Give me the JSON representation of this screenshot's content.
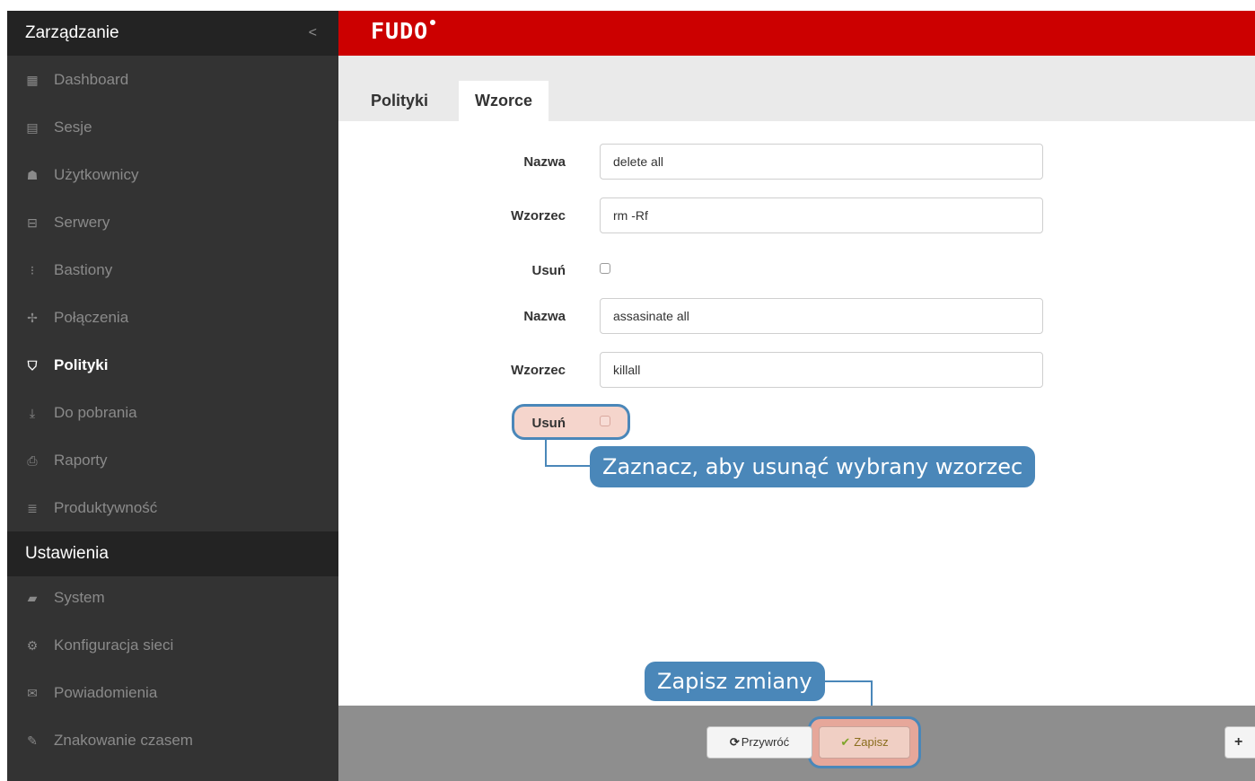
{
  "sidebar": {
    "section1_title": "Zarządzanie",
    "collapse_glyph": "<",
    "items": [
      {
        "label": "Dashboard",
        "icon": "▦",
        "icon_name": "dashboard-icon"
      },
      {
        "label": "Sesje",
        "icon": "▤",
        "icon_name": "film-icon"
      },
      {
        "label": "Użytkownicy",
        "icon": "☗",
        "icon_name": "users-icon"
      },
      {
        "label": "Serwery",
        "icon": "⊟",
        "icon_name": "server-icon"
      },
      {
        "label": "Bastiony",
        "icon": "⁝",
        "icon_name": "bastion-icon"
      },
      {
        "label": "Połączenia",
        "icon": "✢",
        "icon_name": "connections-icon"
      },
      {
        "label": "Polityki",
        "icon": "⛉",
        "icon_name": "shield-icon"
      },
      {
        "label": "Do pobrania",
        "icon": "⤓",
        "icon_name": "download-icon"
      },
      {
        "label": "Raporty",
        "icon": "⎙",
        "icon_name": "print-icon"
      },
      {
        "label": "Produktywność",
        "icon": "≣",
        "icon_name": "productivity-icon"
      }
    ],
    "section2_title": "Ustawienia",
    "items2": [
      {
        "label": "System",
        "icon": "▰",
        "icon_name": "folder-icon"
      },
      {
        "label": "Konfiguracja sieci",
        "icon": "⚙",
        "icon_name": "gears-icon"
      },
      {
        "label": "Powiadomienia",
        "icon": "✉",
        "icon_name": "envelope-icon"
      },
      {
        "label": "Znakowanie czasem",
        "icon": "✎",
        "icon_name": "edit-icon"
      }
    ]
  },
  "header": {
    "logo": "FUDO"
  },
  "tabs": [
    {
      "label": "Polityki",
      "active": false
    },
    {
      "label": "Wzorce",
      "active": true
    }
  ],
  "form": {
    "name_label": "Nazwa",
    "pattern_label": "Wzorzec",
    "delete_label": "Usuń",
    "entries": [
      {
        "name": "delete all",
        "pattern": "rm -Rf",
        "delete_checked": false
      },
      {
        "name": "assasinate all",
        "pattern": "killall",
        "delete_checked": false
      }
    ]
  },
  "callouts": {
    "delete_hint": "Zaznacz, aby usunąć wybrany wzorzec",
    "save_hint": "Zapisz zmiany"
  },
  "footer": {
    "revert_label": "Przywróć",
    "revert_icon": "⟳",
    "save_label": "Zapisz",
    "save_icon": "✔",
    "add_icon": "+"
  },
  "colors": {
    "brand_red": "#cc0000",
    "callout_blue": "#4a87b9",
    "sidebar_bg": "#333333",
    "highlight_fill": "#f5d5cc"
  }
}
